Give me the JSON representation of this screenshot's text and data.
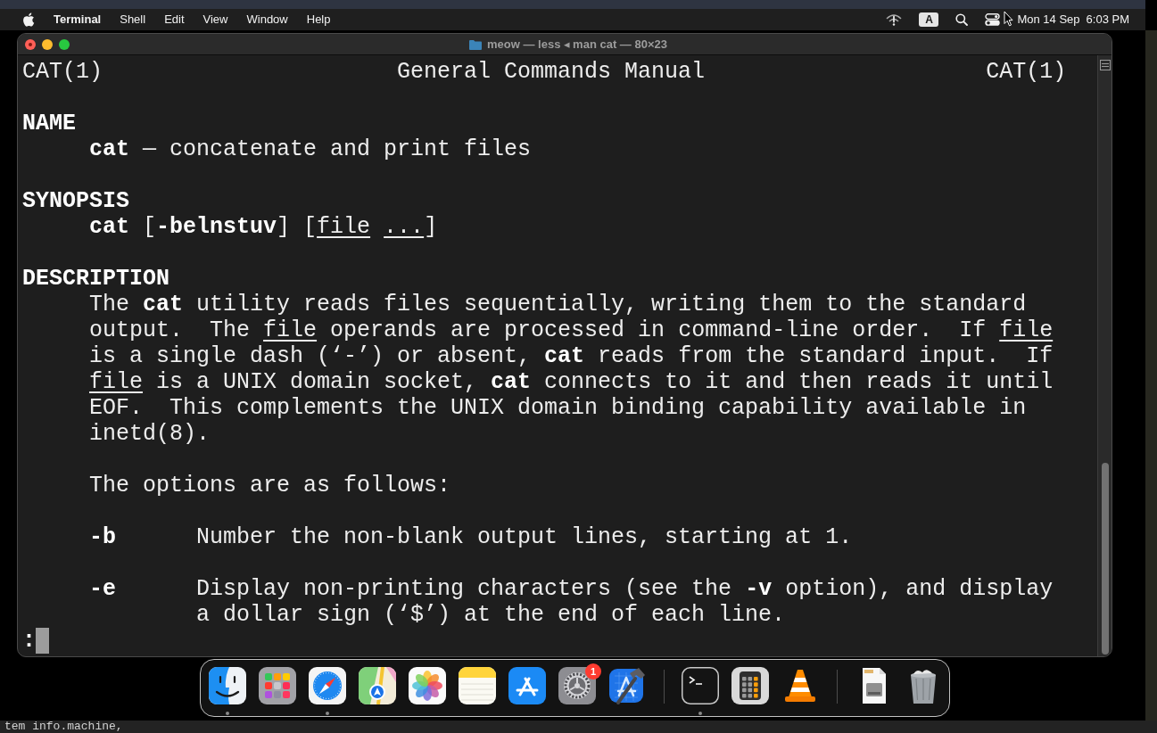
{
  "menu_bar": {
    "app_name": "Terminal",
    "menus": [
      "Shell",
      "Edit",
      "View",
      "Window",
      "Help"
    ],
    "input_source": "A",
    "clock": {
      "date": "Mon 14 Sep",
      "time": "6:03 PM"
    }
  },
  "window": {
    "title": "meow — less ◂ man cat — 80×23",
    "document_edited": true
  },
  "manual": {
    "header": {
      "left": "CAT(1)",
      "center": "General Commands Manual",
      "right": "CAT(1)"
    },
    "sections": [
      {
        "heading": "NAME",
        "blocks": [
          {
            "kind": "paragraph",
            "lines": [
              [
                {
                  "text": "cat",
                  "kind": "bold"
                },
                {
                  "text": " — concatenate and print files",
                  "kind": "plain"
                }
              ]
            ]
          }
        ]
      },
      {
        "heading": "SYNOPSIS",
        "blocks": [
          {
            "kind": "paragraph",
            "lines": [
              [
                {
                  "text": "cat",
                  "kind": "bold"
                },
                {
                  "text": " [",
                  "kind": "plain"
                },
                {
                  "text": "-belnstuv",
                  "kind": "bold"
                },
                {
                  "text": "] [",
                  "kind": "plain"
                },
                {
                  "text": "file",
                  "kind": "underline"
                },
                {
                  "text": " ...",
                  "kind": "underline"
                },
                {
                  "text": "]",
                  "kind": "plain"
                }
              ]
            ]
          }
        ]
      },
      {
        "heading": "DESCRIPTION",
        "blocks": [
          {
            "kind": "paragraph",
            "lines": [
              [
                {
                  "text": "The ",
                  "kind": "plain"
                },
                {
                  "text": "cat",
                  "kind": "bold"
                },
                {
                  "text": " utility reads files sequentially, writing them to the standard",
                  "kind": "plain"
                }
              ],
              [
                {
                  "text": "output.  The ",
                  "kind": "plain"
                },
                {
                  "text": "file",
                  "kind": "underline"
                },
                {
                  "text": " operands are processed in command-line order.  If ",
                  "kind": "plain"
                },
                {
                  "text": "file",
                  "kind": "underline"
                }
              ],
              [
                {
                  "text": "is a single dash (‘-’) or absent, ",
                  "kind": "plain"
                },
                {
                  "text": "cat",
                  "kind": "bold"
                },
                {
                  "text": " reads from the standard input.  If",
                  "kind": "plain"
                }
              ],
              [
                {
                  "text": "file",
                  "kind": "underline"
                },
                {
                  "text": " is a UNIX domain socket, ",
                  "kind": "plain"
                },
                {
                  "text": "cat",
                  "kind": "bold"
                },
                {
                  "text": " connects to it and then reads it until",
                  "kind": "plain"
                }
              ],
              [
                {
                  "text": "EOF.  This complements the UNIX domain binding capability available in",
                  "kind": "plain"
                }
              ],
              [
                {
                  "text": "inetd(8).",
                  "kind": "plain"
                }
              ]
            ]
          },
          {
            "kind": "paragraph",
            "lines": [
              [
                {
                  "text": "The options are as follows:",
                  "kind": "plain"
                }
              ]
            ]
          },
          {
            "kind": "option",
            "flag": "-b",
            "lines": [
              [
                {
                  "text": "Number the non-blank output lines, starting at 1.",
                  "kind": "plain"
                }
              ]
            ]
          },
          {
            "kind": "option",
            "flag": "-e",
            "lines": [
              [
                {
                  "text": "Display non-printing characters (see the ",
                  "kind": "plain"
                },
                {
                  "text": "-v",
                  "kind": "bold"
                },
                {
                  "text": " option), and display",
                  "kind": "plain"
                }
              ],
              [
                {
                  "text": "a dollar sign (‘$’) at the end of each line.",
                  "kind": "plain"
                }
              ]
            ]
          }
        ]
      }
    ]
  },
  "pager": {
    "prompt": ":"
  },
  "dock": {
    "groups": [
      {
        "items": [
          {
            "running": true
          },
          {
            "running": false
          },
          {
            "running": true
          },
          {
            "running": false
          },
          {
            "running": false
          },
          {
            "running": false
          },
          {
            "running": false
          },
          {
            "running": false,
            "badge": "1"
          },
          {
            "running": false
          }
        ]
      },
      {
        "items": [
          {
            "running": true
          },
          {
            "running": false
          },
          {
            "running": false
          }
        ]
      },
      {
        "items": [
          {
            "running": false
          },
          {
            "running": false
          }
        ]
      }
    ]
  },
  "background_terminal": {
    "text": "tem info.machine,"
  }
}
